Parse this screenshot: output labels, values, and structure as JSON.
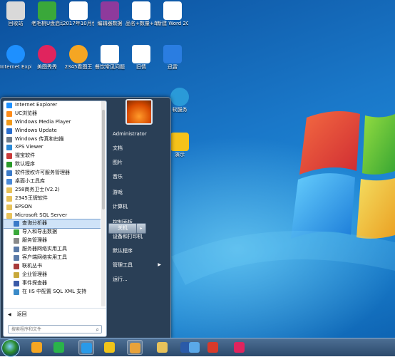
{
  "desktop": {
    "icons": [
      {
        "label": "回收站",
        "glyph": "recycle-bin-icon",
        "color": "#d9d9d9"
      },
      {
        "label": "老毛桃U盘启动制作工具...",
        "glyph": "usb-tool-icon",
        "color": "#3aa83a"
      },
      {
        "label": "2017年10月份事安税品...",
        "glyph": "document-icon",
        "color": "#ffffff"
      },
      {
        "label": "编辑器数据",
        "glyph": "archive-icon",
        "color": "#8e3a9c"
      },
      {
        "label": "品名+数量+单价+小计...",
        "glyph": "document-icon",
        "color": "#ffffff"
      },
      {
        "label": "新建 Word 2003",
        "glyph": "word-doc-icon",
        "color": "#ffffff"
      },
      {
        "label": "Internet Explorer",
        "glyph": "ie-icon",
        "color": "#1e90ff"
      },
      {
        "label": "美图秀秀",
        "glyph": "meitu-icon",
        "color": "#e0245e"
      },
      {
        "label": "2345看图王",
        "glyph": "image-viewer-icon",
        "color": "#f5a623"
      },
      {
        "label": "餐饮常见问题",
        "glyph": "word-doc-icon",
        "color": "#ffffff"
      },
      {
        "label": "旧情",
        "glyph": "word-doc-icon",
        "color": "#ffffff"
      },
      {
        "label": "迅雷",
        "glyph": "xunlei-icon",
        "color": "#2a7de1"
      }
    ],
    "partial_labels": [
      "软服务",
      "演示"
    ]
  },
  "start_menu": {
    "programs": [
      {
        "label": "Internet Explorer",
        "icon": "ie-icon",
        "color": "#1e90ff",
        "indent": false,
        "selected": false
      },
      {
        "label": "UC浏览器",
        "icon": "uc-browser-icon",
        "color": "#ff8c1a",
        "indent": false,
        "selected": false
      },
      {
        "label": "Windows Media Player",
        "icon": "media-player-icon",
        "color": "#f29a1a",
        "indent": false,
        "selected": false
      },
      {
        "label": "Windows Update",
        "icon": "update-icon",
        "color": "#2a6ecf",
        "indent": false,
        "selected": false
      },
      {
        "label": "Windows 传真和扫描",
        "icon": "fax-icon",
        "color": "#6e7b8a",
        "indent": false,
        "selected": false
      },
      {
        "label": "XPS Viewer",
        "icon": "xps-icon",
        "color": "#2a8ad8",
        "indent": false,
        "selected": false
      },
      {
        "label": "猩宝软件",
        "icon": "app-icon",
        "color": "#c83a3a",
        "indent": false,
        "selected": false
      },
      {
        "label": "默认程序",
        "icon": "default-programs-icon",
        "color": "#2a9a2a",
        "indent": false,
        "selected": false
      },
      {
        "label": "软件授权许可服务管理器",
        "icon": "license-icon",
        "color": "#3a7ac8",
        "indent": false,
        "selected": false
      },
      {
        "label": "桌面小工具库",
        "icon": "gadget-icon",
        "color": "#4a8ad8",
        "indent": false,
        "selected": false
      },
      {
        "label": "258商务卫士(V2.2)",
        "icon": "folder-icon",
        "color": "#e8c25a",
        "indent": false,
        "selected": false
      },
      {
        "label": "2345王牌软件",
        "icon": "folder-icon",
        "color": "#e8c25a",
        "indent": false,
        "selected": false
      },
      {
        "label": "EPSON",
        "icon": "folder-icon",
        "color": "#e8c25a",
        "indent": false,
        "selected": false
      },
      {
        "label": "Microsoft SQL Server",
        "icon": "folder-icon",
        "color": "#e8c25a",
        "indent": false,
        "selected": false
      },
      {
        "label": "查询分析器",
        "icon": "query-analyzer-icon",
        "color": "#3a7ac8",
        "indent": true,
        "selected": true
      },
      {
        "label": "导入和导出数据",
        "icon": "import-export-icon",
        "color": "#3aa83a",
        "indent": true,
        "selected": false
      },
      {
        "label": "服务管理器",
        "icon": "service-manager-icon",
        "color": "#8a8a8a",
        "indent": true,
        "selected": false
      },
      {
        "label": "服务器网络实用工具",
        "icon": "network-tool-icon",
        "color": "#5a7aa8",
        "indent": true,
        "selected": false
      },
      {
        "label": "客户端网络实用工具",
        "icon": "network-tool-icon",
        "color": "#5a7aa8",
        "indent": true,
        "selected": false
      },
      {
        "label": "联机丛书",
        "icon": "books-icon",
        "color": "#a83a3a",
        "indent": true,
        "selected": false
      },
      {
        "label": "企业管理器",
        "icon": "enterprise-manager-icon",
        "color": "#c8a83a",
        "indent": true,
        "selected": false
      },
      {
        "label": "事件探查器",
        "icon": "profiler-icon",
        "color": "#3a5aa8",
        "indent": true,
        "selected": false
      },
      {
        "label": "在 IIS 中配置 SQL XML 支持",
        "icon": "iis-icon",
        "color": "#3a8ac8",
        "indent": true,
        "selected": false
      }
    ],
    "back_label": "返回",
    "search_placeholder": "搜索程序和文件",
    "user_name": "Administrator",
    "right_items": [
      {
        "label": "文档",
        "has_arrow": false
      },
      {
        "label": "图片",
        "has_arrow": false
      },
      {
        "label": "音乐",
        "has_arrow": false
      },
      {
        "label": "游戏",
        "has_arrow": false
      },
      {
        "label": "计算机",
        "has_arrow": false
      },
      {
        "label": "控制面板",
        "has_arrow": false
      },
      {
        "label": "设备和打印机",
        "has_arrow": false
      },
      {
        "label": "默认程序",
        "has_arrow": false
      },
      {
        "label": "管理工具",
        "has_arrow": true
      },
      {
        "label": "运行...",
        "has_arrow": false
      }
    ],
    "shutdown_label": "关机"
  },
  "taskbar": {
    "buttons": [
      {
        "name": "taskbar-browser-icon",
        "color": "#f5a623",
        "active": false
      },
      {
        "name": "taskbar-media-player-icon",
        "color": "#2ab34a",
        "active": false
      },
      {
        "name": "taskbar-uc-icon",
        "color": "#2a9ae8",
        "active": true
      },
      {
        "name": "taskbar-ie-icon",
        "color": "#f0c419",
        "active": false
      },
      {
        "name": "taskbar-window-icon",
        "color": "#e8a23a",
        "active": true
      },
      {
        "name": "taskbar-folder-icon",
        "color": "#e8c25a",
        "active": false
      },
      {
        "name": "taskbar-word-icon",
        "color": "#2a5aa8",
        "active": false
      },
      {
        "name": "taskbar-pictures-icon",
        "color": "#5aa8e8",
        "active": false
      },
      {
        "name": "taskbar-sr-icon",
        "color": "#d83a2a",
        "active": false
      },
      {
        "name": "taskbar-meitu-icon",
        "color": "#e0245e",
        "active": false
      }
    ]
  }
}
